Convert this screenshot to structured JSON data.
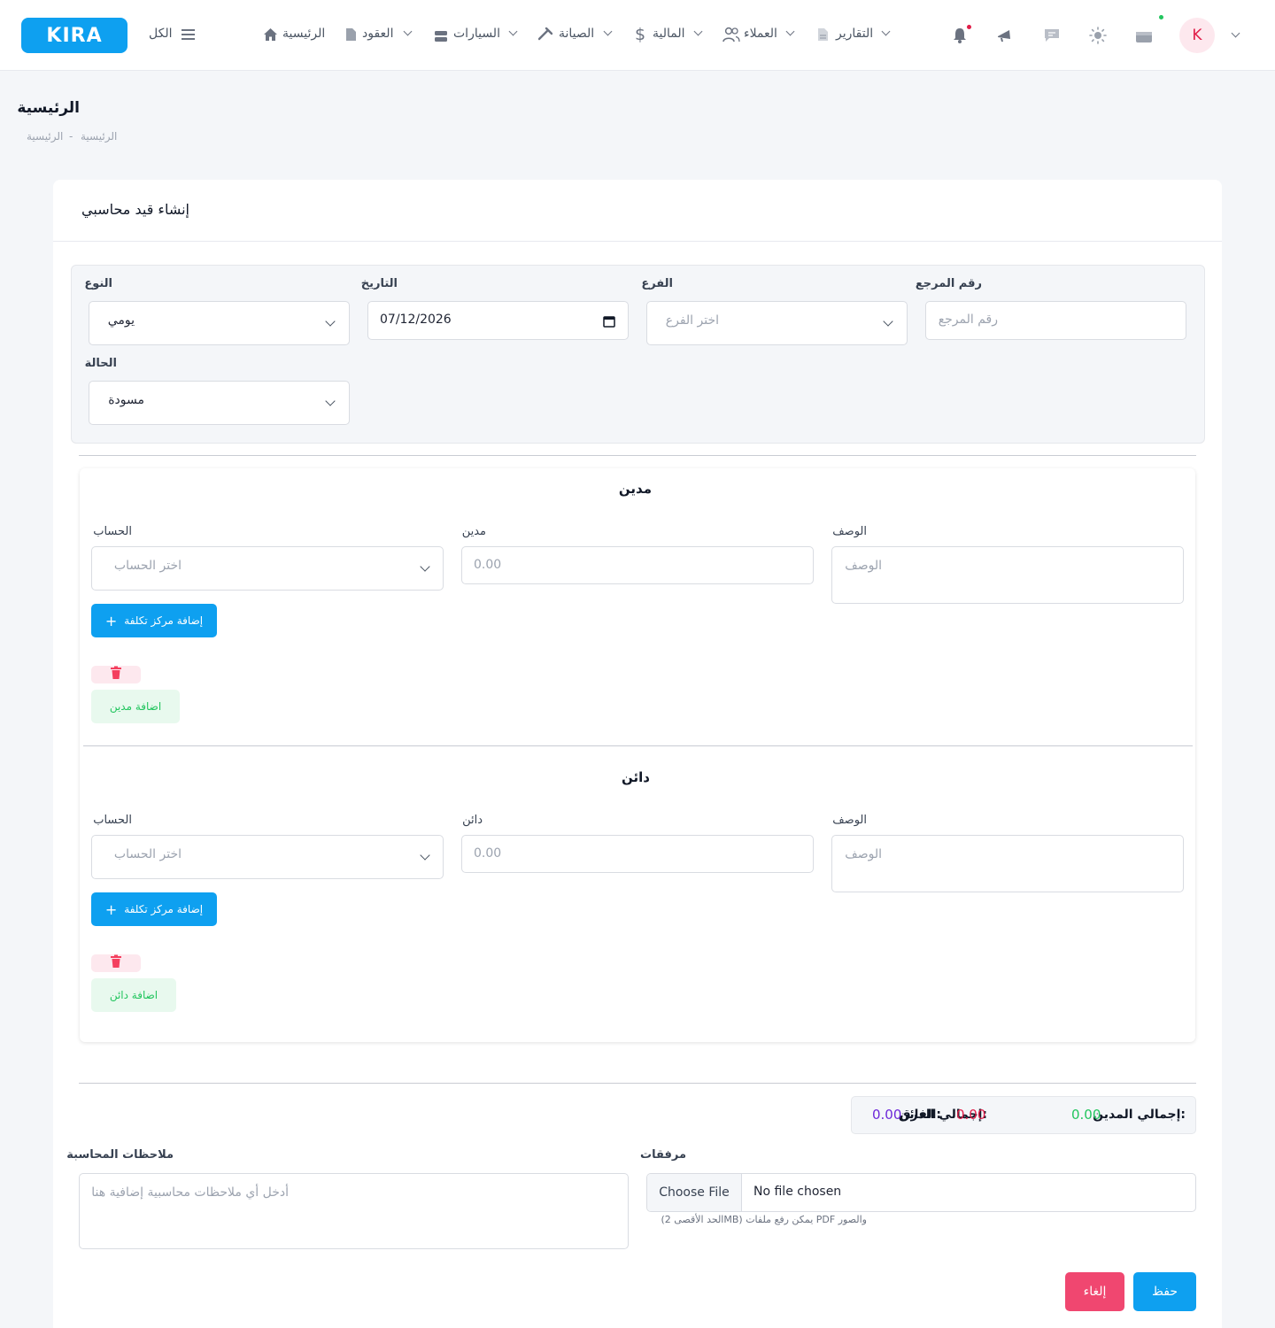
{
  "brand": {
    "logo_text": "KIRA",
    "accent": "#0ea0f0"
  },
  "nav": {
    "menu_label": "الكل",
    "items": [
      {
        "label": "الرئيسية",
        "icon": "home-icon"
      },
      {
        "label": "العقود",
        "icon": "document-icon"
      },
      {
        "label": "السيارات",
        "icon": "car-icon"
      },
      {
        "label": "الصيانة",
        "icon": "wrench-icon"
      },
      {
        "label": "المالية",
        "icon": "dollar-icon"
      },
      {
        "label": "العملاء",
        "icon": "users-icon"
      },
      {
        "label": "التقارير",
        "icon": "report-icon"
      }
    ],
    "toolbar_icons": [
      "bell-icon",
      "megaphone-icon",
      "chat-icon",
      "sun-icon",
      "gift-icon"
    ],
    "avatar_letter": "K"
  },
  "page": {
    "title": "الرئيسية",
    "breadcrumb": [
      "الرئيسية",
      "-",
      "الرئيسية"
    ]
  },
  "card": {
    "title": "إنشاء قيد محاسبي",
    "fields": {
      "reference": {
        "label": "رقم المرجع",
        "placeholder": "رقم المرجع"
      },
      "branch": {
        "label": "الفرع",
        "placeholder": "اختر الفرع"
      },
      "date": {
        "label": "التاريخ",
        "value": "07/12/2026"
      },
      "type": {
        "label": "النوع",
        "value": "يومي"
      },
      "status": {
        "label": "الحالة",
        "value": "مسودة"
      }
    }
  },
  "debit": {
    "title": "مدين",
    "desc_label": "الوصف",
    "desc_placeholder": "الوصف",
    "amount_label": "مدين",
    "amount_placeholder": "0.00",
    "account_label": "الحساب",
    "account_placeholder": "اختر الحساب",
    "cost_center_button": "إضافة مركز تكلفة",
    "add_button": "اضافة مدين"
  },
  "credit": {
    "title": "دائن",
    "desc_label": "الوصف",
    "desc_placeholder": "الوصف",
    "amount_label": "دائن",
    "amount_placeholder": "0.00",
    "account_label": "الحساب",
    "account_placeholder": "اختر الحساب",
    "cost_center_button": "إضافة مركز تكلفة",
    "add_button": "اضافة دائن"
  },
  "totals": {
    "debit_label": "إجمالي المدين:",
    "debit_value": "0.00",
    "credit_label": "إجمالي الدائن:",
    "credit_value": "0.00",
    "diff_label": "الفرق:",
    "diff_value": "0.00",
    "colors": {
      "debit": "#22c55e",
      "credit": "#e11d48",
      "diff": "#6d28d9"
    }
  },
  "attachments": {
    "label": "مرفقات",
    "choose_button": "Choose File",
    "file_status": "No file chosen",
    "hint": "(الحد الأقصى 2MB) يمكن رفع ملفات PDF والصور"
  },
  "notes": {
    "label": "ملاحظات المحاسبة",
    "placeholder": "أدخل أي ملاحظات محاسبية إضافية هنا"
  },
  "actions": {
    "save": "حفظ",
    "cancel": "إلغاء"
  }
}
